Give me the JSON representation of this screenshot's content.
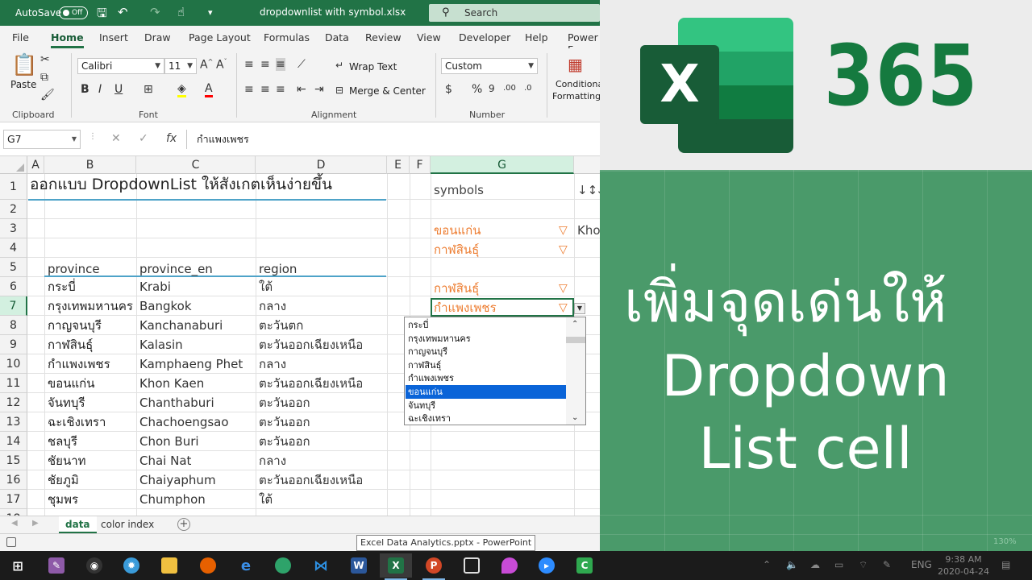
{
  "titlebar": {
    "autosave_label": "AutoSave",
    "autosave_state": "Off",
    "filename": "dropdownlist with symbol.xlsx",
    "search_placeholder": "Search"
  },
  "ribbon": {
    "tabs": [
      "File",
      "Home",
      "Insert",
      "Draw",
      "Page Layout",
      "Formulas",
      "Data",
      "Review",
      "View",
      "Developer",
      "Help",
      "Power F"
    ],
    "active_tab": "Home",
    "clipboard": {
      "paste": "Paste",
      "label": "Clipboard"
    },
    "font": {
      "name": "Calibri",
      "size": "11",
      "label": "Font"
    },
    "alignment": {
      "wrap": "Wrap Text",
      "merge": "Merge & Center",
      "label": "Alignment"
    },
    "number": {
      "format": "Custom",
      "label": "Number"
    },
    "styles": {
      "cond1": "Conditional",
      "cond2": "Formatting"
    }
  },
  "formula_bar": {
    "name_box": "G7",
    "fx": "fx",
    "content": "กำแพงเพชร"
  },
  "grid": {
    "columns": [
      "A",
      "B",
      "C",
      "D",
      "E",
      "F",
      "G"
    ],
    "rows": [
      "1",
      "2",
      "3",
      "4",
      "5",
      "6",
      "7",
      "8",
      "9",
      "10",
      "11",
      "12",
      "13",
      "14",
      "15",
      "16",
      "17",
      "18"
    ],
    "title": "ออกแบบ DropdownList ให้สังเกตเห็นง่ายขึ้น",
    "headers": {
      "b": "province",
      "c": "province_en",
      "d": "region"
    },
    "data": [
      {
        "th": "กระบี่",
        "en": "Krabi",
        "region": "ใต้"
      },
      {
        "th": "กรุงเทพมหานคร",
        "en": "Bangkok",
        "region": "กลาง"
      },
      {
        "th": "กาญจนบุรี",
        "en": "Kanchanaburi",
        "region": "ตะวันตก"
      },
      {
        "th": "กาฬสินธุ์",
        "en": "Kalasin",
        "region": "ตะวันออกเฉียงเหนือ"
      },
      {
        "th": "กำแพงเพชร",
        "en": "Kamphaeng Phet",
        "region": "กลาง"
      },
      {
        "th": "ขอนแก่น",
        "en": "Khon Kaen",
        "region": "ตะวันออกเฉียงเหนือ"
      },
      {
        "th": "จันทบุรี",
        "en": "Chanthaburi",
        "region": "ตะวันออก"
      },
      {
        "th": "ฉะเชิงเทรา",
        "en": "Chachoengsao",
        "region": "ตะวันออก"
      },
      {
        "th": "ชลบุรี",
        "en": "Chon Buri",
        "region": "ตะวันออก"
      },
      {
        "th": "ชัยนาท",
        "en": "Chai Nat",
        "region": "กลาง"
      },
      {
        "th": "ชัยภูมิ",
        "en": "Chaiyaphum",
        "region": "ตะวันออกเฉียงเหนือ"
      },
      {
        "th": "ชุมพร",
        "en": "Chumphon",
        "region": "ใต้"
      }
    ],
    "g1": "symbols",
    "h1": "↓↕⇊|▾▼▽",
    "g3": "ขอนแก่น",
    "h3": "Khon Kaen",
    "g4": "กาฬสินธุ์",
    "g6": "กาฬสินธุ์",
    "g7": "กำแพงเพชร",
    "marker": "▽"
  },
  "dropdown": {
    "items": [
      "กระบี่",
      "กรุงเทพมหานคร",
      "กาญจนบุรี",
      "กาฬสินธุ์",
      "กำแพงเพชร",
      "ขอนแก่น",
      "จันทบุรี",
      "ฉะเชิงเทรา"
    ],
    "selected_index": 5
  },
  "sheet_tabs": {
    "tabs": [
      "data",
      "color index"
    ],
    "active": "data"
  },
  "tooltip": "Excel Data Analytics.pptx - PowerPoint",
  "taskbar": {
    "lang": "ENG",
    "time": "9:38 AM",
    "date": "2020-04-24"
  },
  "promo": {
    "logo_letter": "X",
    "number": "365",
    "line1": "เพิ่มจุดเด่นให้",
    "line2": "Dropdown",
    "line3": "List cell",
    "ghost_zoom": "130%"
  },
  "colors": {
    "excel_green": "#217346",
    "accent_orange": "#ed7d31",
    "promo_green": "#4a9a6a",
    "select_blue": "#0a64d8"
  }
}
